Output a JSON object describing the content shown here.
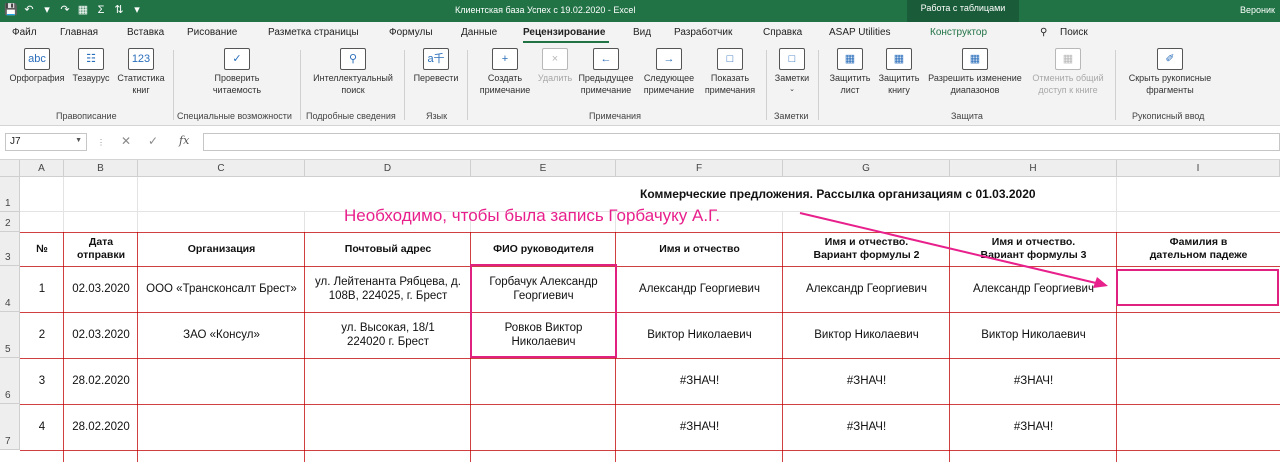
{
  "titlebar": {
    "title": "Клиентская база Успех с 19.02.2020  -  Excel",
    "context": "Работа с таблицами",
    "user": "Вероник"
  },
  "tabs": [
    "Файл",
    "Главная",
    "Вставка",
    "Рисование",
    "Разметка страницы",
    "Формулы",
    "Данные",
    "Рецензирование",
    "Вид",
    "Разработчик",
    "Справка",
    "ASAP Utilities",
    "Конструктор",
    "Поиск"
  ],
  "ribbon": {
    "buttons": {
      "spelling": "Орфография",
      "thesaurus": "Тезаурус",
      "stats": "Статистика книг",
      "readability": "Проверить читаемость",
      "smart_lookup": "Интеллектуальный поиск",
      "translate": "Перевести",
      "new_comment": "Создать примечание",
      "delete": "Удалить",
      "prev_comment": "Предыдущее примечание",
      "next_comment": "Следующее примечание",
      "show_comment": "Показать примечания",
      "notes": "Заметки",
      "protect_sheet": "Защитить лист",
      "protect_book": "Защитить книгу",
      "allow_edit": "Разрешить изменение диапазонов",
      "unshare": "Отменить общий доступ к книге",
      "hide_ink": "Скрыть рукописные фрагменты"
    },
    "groups": {
      "proofing": "Правописание",
      "accessibility": "Специальные возможности",
      "insights": "Подробные сведения",
      "language": "Язык",
      "comments": "Примечания",
      "notes": "Заметки",
      "protect": "Защита",
      "ink": "Рукописный ввод"
    }
  },
  "formula_bar": {
    "name_box": "J7",
    "fx": "fx",
    "value": ""
  },
  "sheet": {
    "columns": [
      "A",
      "B",
      "C",
      "D",
      "E",
      "F",
      "G",
      "H",
      "I"
    ],
    "rows": [
      "1",
      "2",
      "3",
      "4",
      "5",
      "6",
      "7"
    ],
    "banner": "Коммерческие предложения. Рассылка организациям с 01.03.2020",
    "note": "Необходимо, чтобы была запись Горбачуку А.Г.",
    "headers": [
      "№",
      "Дата отправки",
      "Организация",
      "Почтовый адрес",
      "ФИО руководителя",
      "Имя и отчество",
      "Имя и отчество. Вариант формулы 2",
      "Имя и отчество. Вариант формулы 3",
      "Фамилия в дательном падеже"
    ],
    "data": [
      [
        "1",
        "02.03.2020",
        "ООО «Трансконсалт Брест»",
        "ул. Лейтенанта Рябцева, д. 108В, 224025, г. Брест",
        "Горбачук Александр Георгиевич",
        "Александр Георгиевич",
        "Александр Георгиевич",
        "Александр Георгиевич",
        ""
      ],
      [
        "2",
        "02.03.2020",
        "ЗАО «Консул»",
        "ул. Высокая, 18/1 224020 г. Брест",
        "Ровков Виктор Николаевич",
        "Виктор Николаевич",
        "Виктор Николаевич",
        "Виктор Николаевич",
        ""
      ],
      [
        "3",
        "28.02.2020",
        "",
        "",
        "",
        "#ЗНАЧ!",
        "#ЗНАЧ!",
        "#ЗНАЧ!",
        ""
      ],
      [
        "4",
        "28.02.2020",
        "",
        "",
        "",
        "#ЗНАЧ!",
        "#ЗНАЧ!",
        "#ЗНАЧ!",
        ""
      ]
    ]
  },
  "colors": {
    "excel_green": "#217346",
    "border_red": "#c00000",
    "annotation_pink": "#e0217f"
  }
}
